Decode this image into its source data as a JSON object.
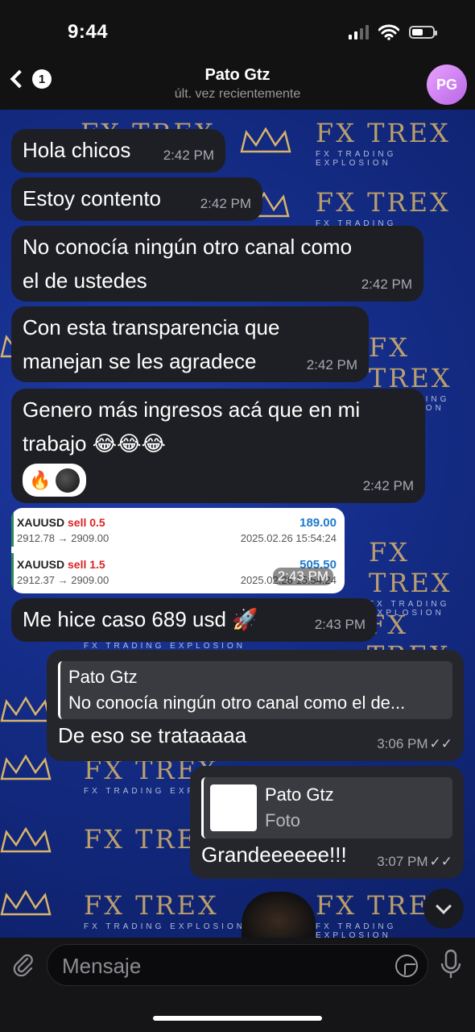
{
  "status": {
    "time": "9:44"
  },
  "header": {
    "back_badge": "1",
    "contact_name": "Pato Gtz",
    "last_seen": "últ. vez recientemente",
    "avatar_initials": "PG"
  },
  "watermark": {
    "brand": "FX TREX",
    "tagline": "FX TRADING EXPLOSION"
  },
  "messages": {
    "m1": {
      "text": "Hola chicos",
      "time": "2:42 PM"
    },
    "m2": {
      "text": "Estoy contento",
      "time": "2:42 PM"
    },
    "m3": {
      "line1": "No conocía ningún otro canal como",
      "line2": "el de ustedes",
      "time": "2:42 PM"
    },
    "m4": {
      "line1": "Con esta transparencia que",
      "line2": "manejan se les agradece",
      "time": "2:42 PM"
    },
    "m5": {
      "line1": "Genero más ingresos acá que en mi",
      "line2": "trabajo 😂😂😂",
      "reaction": "🔥",
      "time": "2:42 PM"
    },
    "m6": {
      "time": "2:43 PM",
      "trades": [
        {
          "symbol": "XAUUSD",
          "side": "sell 0.5",
          "profit": "189.00",
          "prices": "2912.78 → 2909.00",
          "date": "2025.02.26 15:54:24"
        },
        {
          "symbol": "XAUUSD",
          "side": "sell 1.5",
          "profit": "505.50",
          "prices": "2912.37 → 2909.00",
          "date": "2025.02.26 15:54:24"
        }
      ]
    },
    "m7": {
      "text": "Me hice caso 689 usd 🚀",
      "time": "2:43 PM"
    },
    "m8": {
      "reply_name": "Pato Gtz",
      "reply_text": "No conocía ningún otro canal como el de...",
      "text": "De eso se trataaaaa",
      "time": "3:06 PM",
      "check": "✓✓"
    },
    "m9": {
      "reply_name": "Pato Gtz",
      "reply_text": "Foto",
      "text": "Grandeeeeee!!!",
      "time": "3:07 PM",
      "check": "✓✓"
    }
  },
  "input": {
    "placeholder": "Mensaje"
  },
  "colors": {
    "accent_blue": "#1f7acc",
    "sell_red": "#d22222",
    "brand_gold": "#d8b46a"
  }
}
